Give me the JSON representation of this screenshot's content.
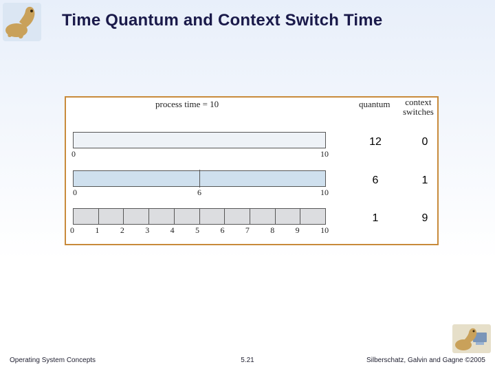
{
  "title": "Time Quantum and Context Switch Time",
  "diagram": {
    "process_time_label": "process time = 10",
    "quantum_label": "quantum",
    "context_switch_label_l1": "context",
    "context_switch_label_l2": "switches",
    "rows": [
      {
        "quantum": "12",
        "switches": "0",
        "left_tick": "0",
        "right_tick": "10"
      },
      {
        "quantum": "6",
        "switches": "1",
        "left_tick": "0",
        "mid_tick": "6",
        "right_tick": "10"
      },
      {
        "quantum": "1",
        "switches": "9",
        "ticks": [
          "0",
          "1",
          "2",
          "3",
          "4",
          "5",
          "6",
          "7",
          "8",
          "9",
          "10"
        ]
      }
    ]
  },
  "footer": {
    "left": "Operating System Concepts",
    "center": "5.21",
    "right": "Silberschatz, Galvin and Gagne ©2005"
  },
  "chart_data": {
    "type": "table",
    "title": "Time Quantum and Context Switch Time",
    "process_time": 10,
    "columns": [
      "quantum",
      "context_switches"
    ],
    "rows": [
      {
        "quantum": 12,
        "context_switches": 0
      },
      {
        "quantum": 6,
        "context_switches": 1
      },
      {
        "quantum": 1,
        "context_switches": 9
      }
    ]
  }
}
